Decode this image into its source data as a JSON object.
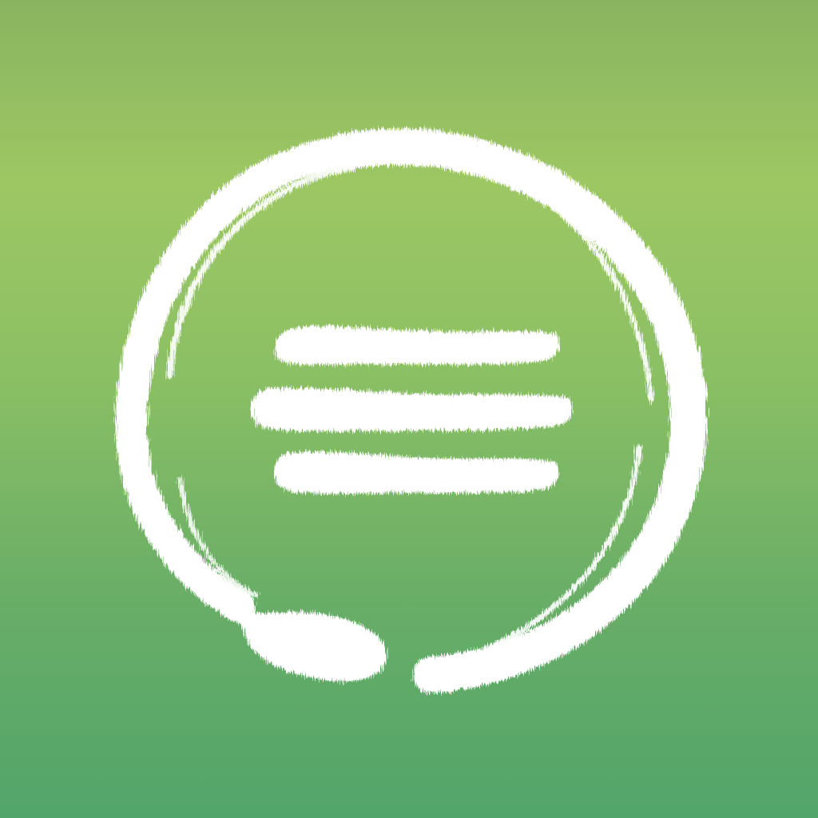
{
  "app_icon": {
    "name": "enso-menu-icon",
    "colors": {
      "background_top": "#8ab460",
      "background_mid": "#9dc763",
      "background_bottom": "#52a56a",
      "mark": "#ffffff"
    },
    "icon": "enso-circle-with-three-brush-lines"
  }
}
